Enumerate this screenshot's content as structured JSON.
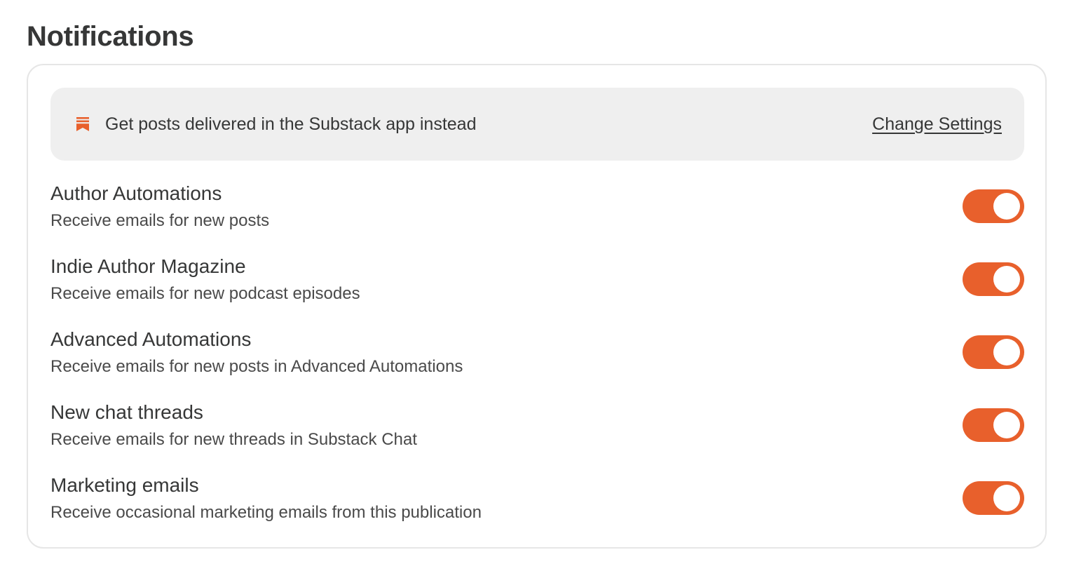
{
  "page": {
    "title": "Notifications"
  },
  "banner": {
    "icon": "substack-logo-icon",
    "text": "Get posts delivered in the Substack app instead",
    "link_label": "Change Settings"
  },
  "colors": {
    "accent": "#e8602c",
    "banner_bg": "#efefef",
    "text": "#363737"
  },
  "settings": [
    {
      "title": "Author Automations",
      "description": "Receive emails for new posts",
      "enabled": true
    },
    {
      "title": "Indie Author Magazine",
      "description": "Receive emails for new podcast episodes",
      "enabled": true
    },
    {
      "title": "Advanced Automations",
      "description": "Receive emails for new posts in Advanced Automations",
      "enabled": true
    },
    {
      "title": "New chat threads",
      "description": "Receive emails for new threads in Substack Chat",
      "enabled": true
    },
    {
      "title": "Marketing emails",
      "description": "Receive occasional marketing emails from this publication",
      "enabled": true
    }
  ]
}
